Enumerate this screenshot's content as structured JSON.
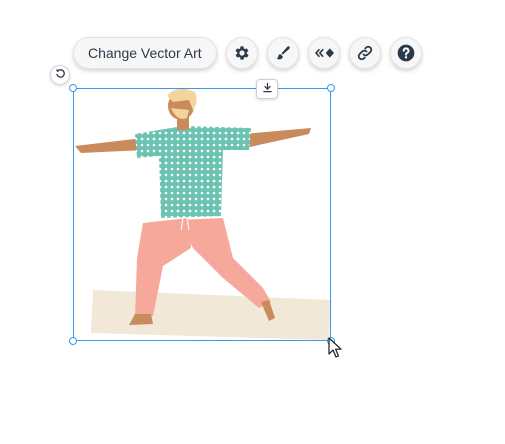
{
  "toolbar": {
    "change_vector_art_label": "Change Vector Art",
    "buttons": [
      {
        "name": "settings",
        "icon": "gear-icon"
      },
      {
        "name": "design",
        "icon": "paintbrush-icon"
      },
      {
        "name": "animation",
        "icon": "animation-icon"
      },
      {
        "name": "link",
        "icon": "link-icon"
      },
      {
        "name": "help",
        "icon": "question-icon"
      }
    ]
  },
  "selection": {
    "rotate_icon": "rotate-icon",
    "download_icon": "download-icon"
  },
  "vector_art": {
    "description_icon": "yoga-man-illustration"
  },
  "colors": {
    "selection_blue": "#3899ec",
    "icon_dark": "#2b3a4a",
    "shirt_teal": "#6cc3b1",
    "pants_pink": "#f6a99a",
    "skin": "#c98b5c",
    "hair": "#f3d49b",
    "floor": "#f2e8d7"
  }
}
